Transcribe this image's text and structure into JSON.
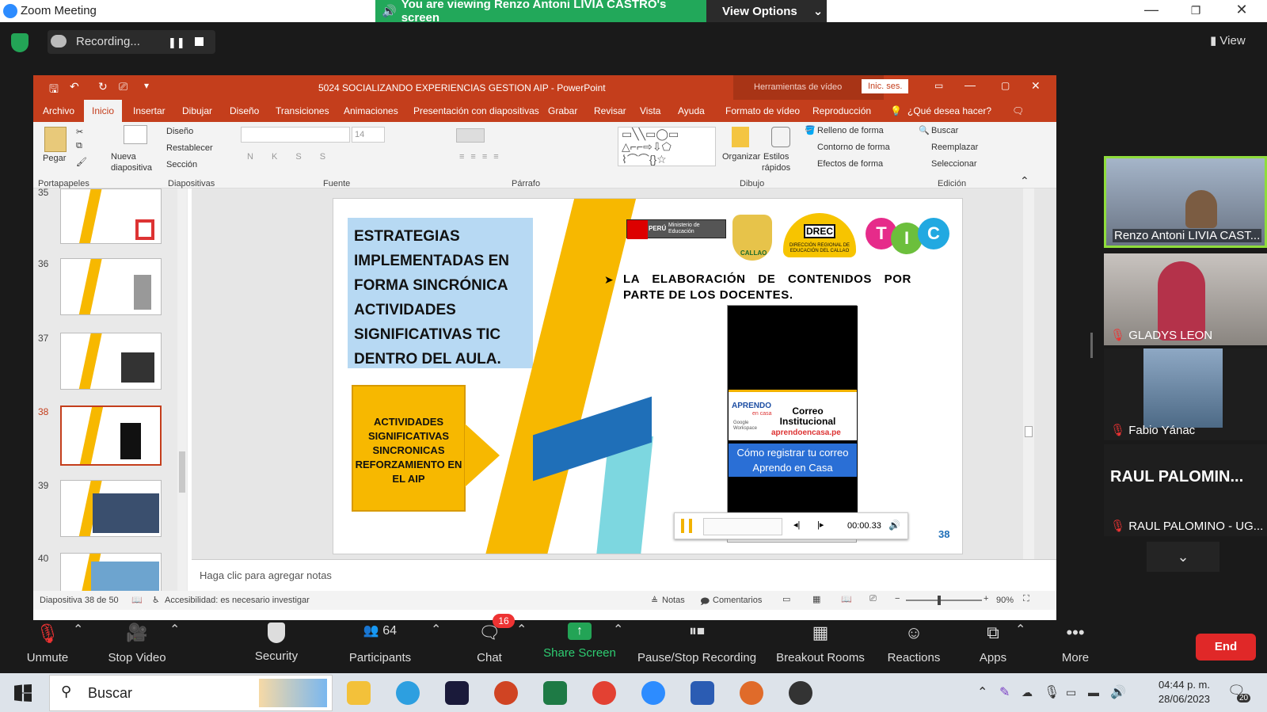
{
  "zoom": {
    "title": "Zoom Meeting",
    "banner": "You are viewing Renzo Antoni LIVIA CASTRO's screen",
    "view_options": "View Options",
    "recording": "Recording...",
    "view": "View"
  },
  "ppt": {
    "title": "5024 SOCIALIZANDO EXPERIENCIAS GESTION AIP  -  PowerPoint",
    "tools_label": "Herramientas de vídeo",
    "signin": "Inic. ses.",
    "menu": [
      "Archivo",
      "Inicio",
      "Insertar",
      "Dibujar",
      "Diseño",
      "Transiciones",
      "Animaciones",
      "Presentación con diapositivas",
      "Grabar",
      "Revisar",
      "Vista",
      "Ayuda",
      "Formato de vídeo",
      "Reproducción"
    ],
    "tell": "¿Qué desea hacer?",
    "ribbon": {
      "pegar": "Pegar",
      "nueva": "Nueva",
      "diapositiva": "diapositiva",
      "diseno": "Diseño",
      "restablecer": "Restablecer",
      "seccion": "Sección",
      "fontsize": "14",
      "organizar": "Organizar",
      "estilos": "Estilos",
      "rapidos": "rápidos",
      "relleno": "Relleno de forma",
      "contorno": "Contorno de forma",
      "efectos": "Efectos de forma",
      "buscar": "Buscar",
      "reemplazar": "Reemplazar",
      "seleccionar": "Seleccionar",
      "groups": [
        "Portapapeles",
        "Diapositivas",
        "Fuente",
        "Párrafo",
        "Dibujo",
        "Edición"
      ]
    },
    "thumbs": [
      "35",
      "36",
      "37",
      "38",
      "39",
      "40"
    ],
    "slide": {
      "heading": "ESTRATEGIAS IMPLEMENTADAS EN FORMA SINCRÓNICA ACTIVIDADES SIGNIFICATIVAS TIC DENTRO DEL AULA.",
      "box": "ACTIVIDADES SIGNIFICATIVAS SINCRONICAS REFORZAMIENTO EN EL AIP",
      "bullet": "LA ELABORACIÓN DE CONTENIDOS POR PARTE DE LOS DOCENTES.",
      "number": "38",
      "minedu": "Ministerio de Educación",
      "peru": "PERÚ",
      "callao": "CALLAO",
      "drec": "DREC",
      "drec_sub": "DIRECCIÓN REGIONAL DE EDUCACIÓN DEL CALLAO",
      "tic": [
        "T",
        "I",
        "C"
      ],
      "video": {
        "aprendo": "APRENDO",
        "encasa": "en casa",
        "correo": "Correo Institucional",
        "url": "aprendoencasa.pe",
        "google": "Google Workspace",
        "caption": "Cómo registrar tu correo Aprendo en Casa",
        "time": "00:00.33"
      }
    },
    "notes": "Haga clic para agregar notas",
    "status": {
      "slide": "Diapositiva 38 de 50",
      "access": "Accesibilidad: es necesario investigar",
      "notas": "Notas",
      "comentarios": "Comentarios",
      "zoom": "90%"
    }
  },
  "participants": [
    {
      "name": "Renzo Antoni LIVIA CAST..."
    },
    {
      "name": "GLADYS LEON"
    },
    {
      "name": "Fabio Yánac"
    },
    {
      "name": "RAUL PALOMINO - UG...",
      "big": "RAUL PALOMIN..."
    }
  ],
  "toolbar": {
    "unmute": "Unmute",
    "stop_video": "Stop Video",
    "security": "Security",
    "participants": "Participants",
    "participants_count": "64",
    "chat": "Chat",
    "chat_badge": "16",
    "share": "Share Screen",
    "pause": "Pause/Stop Recording",
    "breakout": "Breakout Rooms",
    "reactions": "Reactions",
    "apps": "Apps",
    "more": "More",
    "end": "End"
  },
  "taskbar": {
    "search": "Buscar",
    "time": "04:44 p. m.",
    "date": "28/06/2023",
    "notif": "20"
  }
}
